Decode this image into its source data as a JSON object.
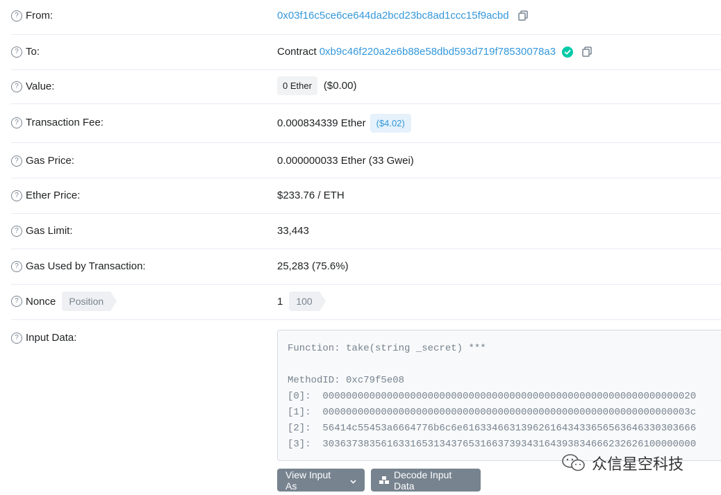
{
  "rows": {
    "from": {
      "label": "From:",
      "address": "0x03f16c5ce6ce644da2bcd23bc8ad1ccc15f9acbd"
    },
    "to": {
      "label": "To:",
      "prefix": "Contract",
      "address": "0xb9c46f220a2e6b88e58dbd593d719f78530078a3"
    },
    "value": {
      "label": "Value:",
      "badge": "0 Ether",
      "usd": "($0.00)"
    },
    "fee": {
      "label": "Transaction Fee:",
      "amount": "0.000834339 Ether",
      "usd": "($4.02)"
    },
    "gas_price": {
      "label": "Gas Price:",
      "amount": "0.000000033 Ether (33 Gwei)"
    },
    "ether_price": {
      "label": "Ether Price:",
      "amount": "$233.76 / ETH"
    },
    "gas_limit": {
      "label": "Gas Limit:",
      "amount": "33,443"
    },
    "gas_used": {
      "label": "Gas Used by Transaction:",
      "amount": "25,283 (75.6%)"
    },
    "nonce": {
      "label": "Nonce",
      "tag": "Position",
      "value": "1",
      "position": "100"
    },
    "input_data": {
      "label": "Input Data:",
      "content": "Function: take(string _secret) ***\n\nMethodID: 0xc79f5e08\n[0]:  0000000000000000000000000000000000000000000000000000000000000020\n[1]:  000000000000000000000000000000000000000000000000000000000000003c\n[2]:  56414c55453a6664776b6c6e6163346631396261643433656563646330303666\n[3]:  3036373835616331653134376531663739343164393834666232626100000000"
    }
  },
  "buttons": {
    "view_input_as": "View Input As",
    "decode_input_data": "Decode Input Data"
  },
  "help_glyph": "?",
  "watermark": "众信星空科技",
  "colors": {
    "link": "#3498db",
    "verified": "#00c9a7",
    "button": "#77838f"
  }
}
